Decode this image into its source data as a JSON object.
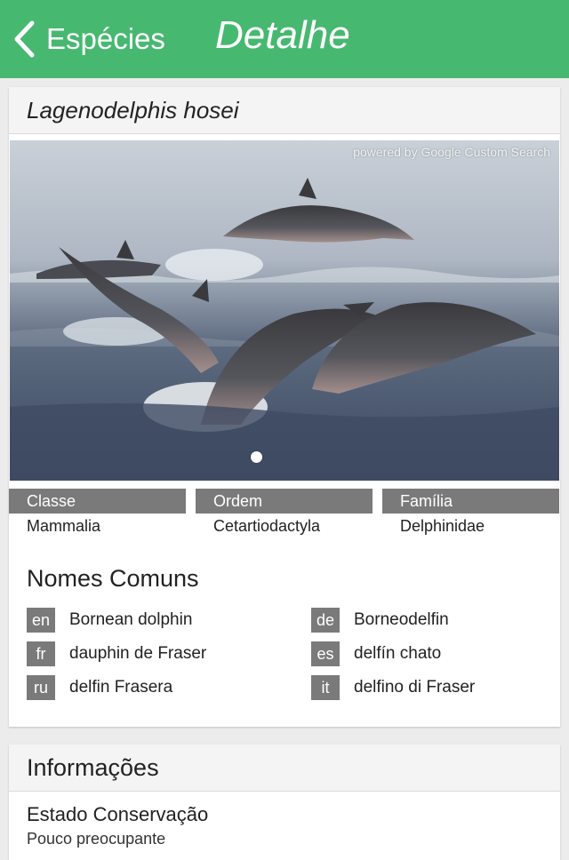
{
  "navbar": {
    "back_label": "Espécies",
    "title": "Detalhe",
    "color": "#47b870"
  },
  "species": {
    "name": "Lagenodelphis hosei",
    "image_credit": "powered by Google Custom Search",
    "image_page": 1,
    "image_page_count": 1
  },
  "taxonomy": [
    {
      "label": "Classe",
      "value": "Mammalia"
    },
    {
      "label": "Ordem",
      "value": "Cetartiodactyla"
    },
    {
      "label": "Família",
      "value": "Delphinidae"
    }
  ],
  "common_names": {
    "title": "Nomes Comuns",
    "items": [
      {
        "lang": "en",
        "name": "Bornean dolphin"
      },
      {
        "lang": "de",
        "name": "Borneodelfin"
      },
      {
        "lang": "fr",
        "name": "dauphin de Fraser"
      },
      {
        "lang": "es",
        "name": "delfín chato"
      },
      {
        "lang": "ru",
        "name": "delfin Frasera"
      },
      {
        "lang": "it",
        "name": "delfino di Fraser"
      }
    ]
  },
  "info": {
    "title": "Informações",
    "conservation_label": "Estado Conservação",
    "conservation_value": "Pouco preocupante"
  },
  "icons": {
    "back": "chevron-left-icon"
  }
}
